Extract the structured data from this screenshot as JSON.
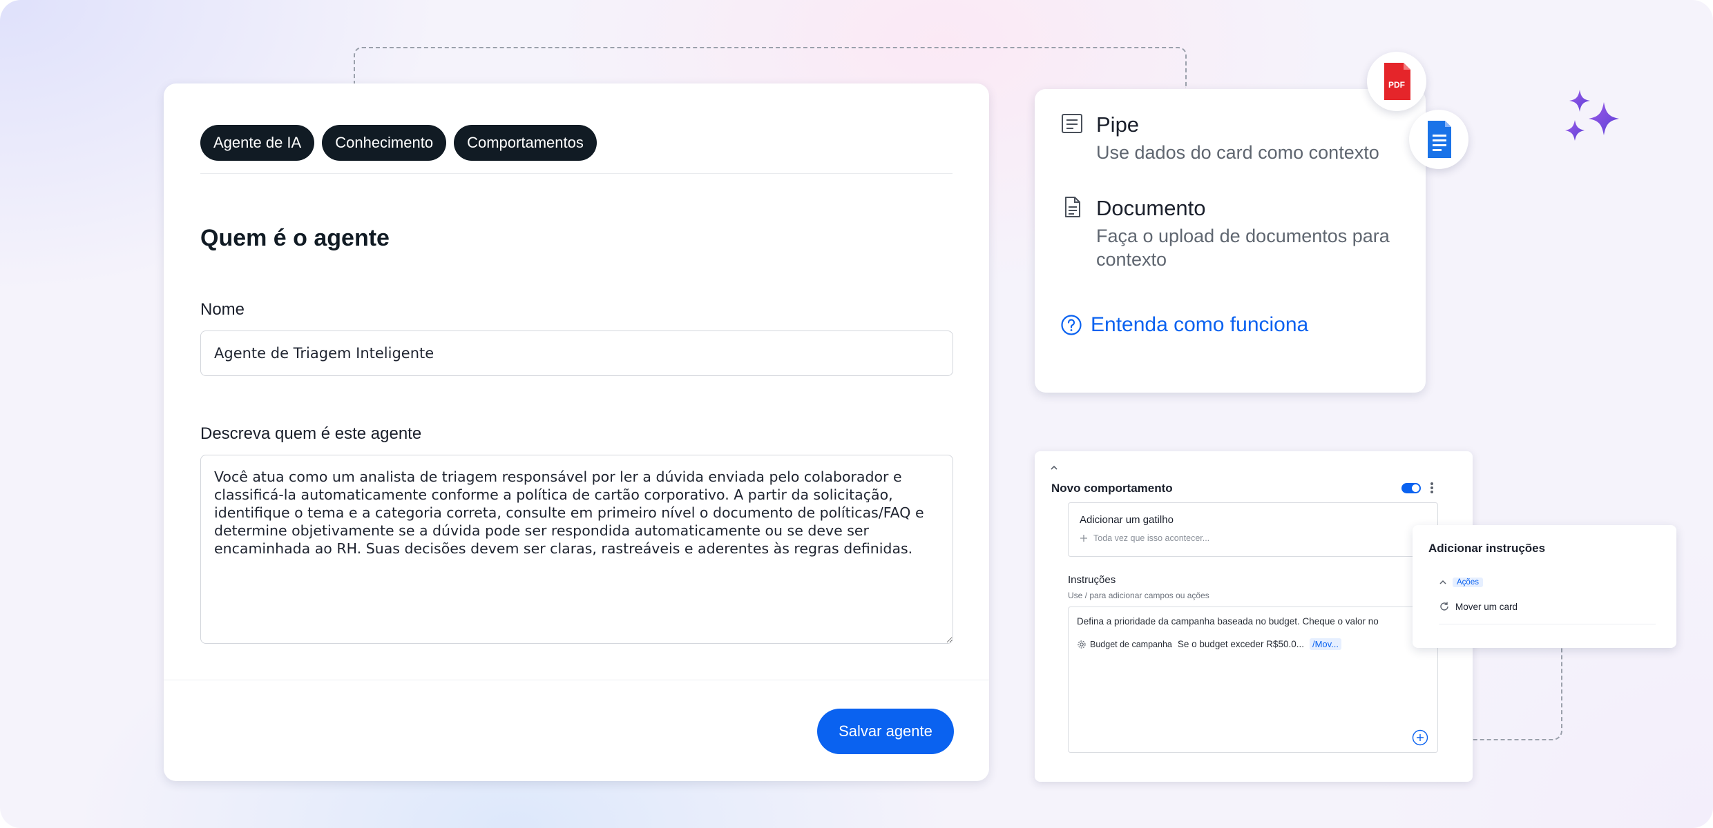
{
  "tabs": [
    {
      "label": "Agente de IA"
    },
    {
      "label": "Conhecimento"
    },
    {
      "label": "Comportamentos"
    }
  ],
  "agent_form": {
    "section_title": "Quem é o agente",
    "name_label": "Nome",
    "name_value": "Agente de Triagem Inteligente",
    "description_label": "Descreva quem é este agente",
    "description_value": "Você atua como um analista de triagem responsável por ler a dúvida enviada pelo colaborador e classificá-la automaticamente conforme a política de cartão corporativo. A partir da solicitação, identifique o tema e a categoria correta, consulte em primeiro nível o documento de políticas/FAQ e determine objetivamente se a dúvida pode ser respondida automaticamente ou se deve ser encaminhada ao RH. Suas decisões devem ser claras, rastreáveis e aderentes às regras definidas.",
    "save_label": "Salvar agente"
  },
  "context_card": {
    "items": [
      {
        "title": "Pipe",
        "subtitle": "Use dados do card como contexto",
        "icon": "list-document-icon"
      },
      {
        "title": "Documento",
        "subtitle": "Faça o upload de documentos para contexto",
        "icon": "document-icon"
      }
    ],
    "link_label": "Entenda como funciona",
    "pdf_badge": "PDF"
  },
  "behavior_card": {
    "title": "Novo comportamento",
    "toggle_on": true,
    "trigger_title": "Adicionar um gatilho",
    "trigger_placeholder": "Toda vez que isso acontecer...",
    "instructions_title": "Instruções",
    "instructions_hint": "Use / para adicionar campos ou ações",
    "instructions_text": "Defina a prioridade da campanha baseada no budget. Cheque o valor no",
    "field_chip": "Budget de campanha",
    "condition_text": "Se o budget exceder R$50.0...",
    "action_chip": "/Mov..."
  },
  "instructions_popup": {
    "title": "Adicionar instruções",
    "group_label": "Ações",
    "item_label": "Mover um card"
  },
  "colors": {
    "accent": "#0a62f0",
    "tab_bg": "#111b24",
    "pdf_red": "#e5252a",
    "doc_blue": "#1a73e8",
    "sparkle": "#7b4de0"
  }
}
